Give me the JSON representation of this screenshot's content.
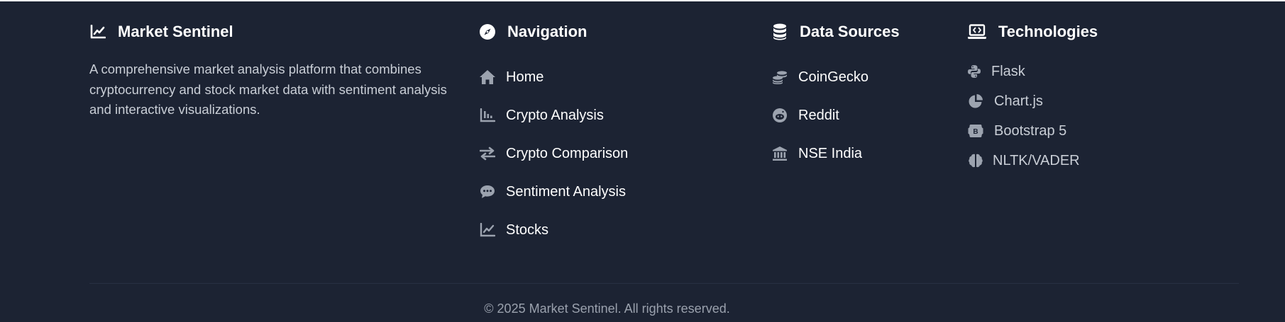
{
  "brand": {
    "title": "Market Sentinel",
    "icon": "chart-line-icon",
    "description": "A comprehensive market analysis platform that combines cryptocurrency and stock market data with sentiment analysis and interactive visualizations."
  },
  "navigation": {
    "title": "Navigation",
    "icon": "compass-icon",
    "items": [
      {
        "label": "Home",
        "icon": "home-icon"
      },
      {
        "label": "Crypto Analysis",
        "icon": "bar-chart-icon"
      },
      {
        "label": "Crypto Comparison",
        "icon": "exchange-arrows-icon"
      },
      {
        "label": "Sentiment Analysis",
        "icon": "speech-bubble-icon"
      },
      {
        "label": "Stocks",
        "icon": "line-chart-icon"
      }
    ]
  },
  "data_sources": {
    "title": "Data Sources",
    "icon": "database-icon",
    "items": [
      {
        "label": "CoinGecko",
        "icon": "coins-icon"
      },
      {
        "label": "Reddit",
        "icon": "reddit-icon"
      },
      {
        "label": "NSE India",
        "icon": "bank-building-icon"
      }
    ]
  },
  "technologies": {
    "title": "Technologies",
    "icon": "laptop-code-icon",
    "items": [
      {
        "label": "Flask",
        "icon": "python-icon"
      },
      {
        "label": "Chart.js",
        "icon": "pie-chart-icon"
      },
      {
        "label": "Bootstrap 5",
        "icon": "bootstrap-icon"
      },
      {
        "label": "NLTK/VADER",
        "icon": "brain-icon"
      }
    ]
  },
  "footer": {
    "copyright": "© 2025 Market Sentinel. All rights reserved."
  },
  "colors": {
    "background": "#1c2333",
    "heading": "#ffffff",
    "text_muted": "#c9ced6",
    "icon_muted": "#9ca3af",
    "copyright": "#9aa1ad"
  }
}
